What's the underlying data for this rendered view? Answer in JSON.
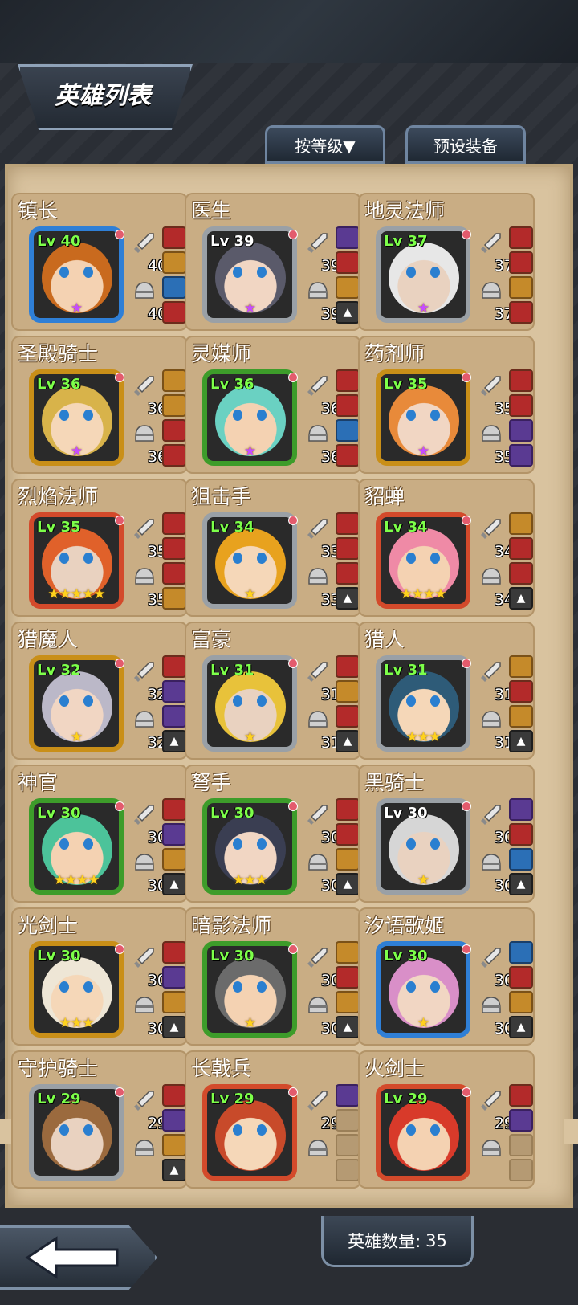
{
  "header": {
    "title": "英雄列表",
    "sort_label": "按等级▼",
    "preset_label": "预设装备"
  },
  "footer": {
    "count_label": "英雄数量:",
    "count_value": "35"
  },
  "heroes": [
    {
      "name": "镇长",
      "level": "Lv 40",
      "attack": "40",
      "defense": "40",
      "stars": "★",
      "star_color": "purple",
      "frame": "blue",
      "lv_color": "green"
    },
    {
      "name": "医生",
      "level": "Lv 39",
      "attack": "39",
      "defense": "39",
      "stars": "★",
      "star_color": "purple",
      "frame": "gray",
      "lv_color": "white"
    },
    {
      "name": "地灵法师",
      "level": "Lv 37",
      "attack": "37",
      "defense": "37",
      "stars": "★",
      "star_color": "purple",
      "frame": "gray",
      "lv_color": "green"
    },
    {
      "name": "圣殿骑士",
      "level": "Lv 36",
      "attack": "36",
      "defense": "36",
      "stars": "★",
      "star_color": "purple",
      "frame": "gold",
      "lv_color": "green"
    },
    {
      "name": "灵媒师",
      "level": "Lv 36",
      "attack": "36",
      "defense": "36",
      "stars": "★",
      "star_color": "purple",
      "frame": "green",
      "lv_color": "green"
    },
    {
      "name": "药剂师",
      "level": "Lv 35",
      "attack": "35",
      "defense": "35",
      "stars": "★",
      "star_color": "purple",
      "frame": "gold",
      "lv_color": "green"
    },
    {
      "name": "烈焰法师",
      "level": "Lv 35",
      "attack": "35",
      "defense": "35",
      "stars": "★★★★★",
      "star_color": "gold",
      "frame": "red",
      "lv_color": "green"
    },
    {
      "name": "狙击手",
      "level": "Lv 34",
      "attack": "33",
      "defense": "33",
      "stars": "★",
      "star_color": "gold",
      "frame": "gray",
      "lv_color": "green"
    },
    {
      "name": "貂蝉",
      "level": "Lv 34",
      "attack": "34",
      "defense": "34",
      "stars": "★★★★",
      "star_color": "gold",
      "frame": "red",
      "lv_color": "green"
    },
    {
      "name": "猎魔人",
      "level": "Lv 32",
      "attack": "32",
      "defense": "32",
      "stars": "★",
      "star_color": "gold",
      "frame": "gold",
      "lv_color": "green"
    },
    {
      "name": "富豪",
      "level": "Lv 31",
      "attack": "31",
      "defense": "31",
      "stars": "★",
      "star_color": "gold",
      "frame": "gray",
      "lv_color": "green"
    },
    {
      "name": "猎人",
      "level": "Lv 31",
      "attack": "31",
      "defense": "31",
      "stars": "★★★",
      "star_color": "gold",
      "frame": "gray",
      "lv_color": "green"
    },
    {
      "name": "神官",
      "level": "Lv 30",
      "attack": "30",
      "defense": "30",
      "stars": "★★★★",
      "star_color": "gold",
      "frame": "green",
      "lv_color": "green"
    },
    {
      "name": "弩手",
      "level": "Lv 30",
      "attack": "30",
      "defense": "30",
      "stars": "★★★",
      "star_color": "gold",
      "frame": "green",
      "lv_color": "green"
    },
    {
      "name": "黑骑士",
      "level": "Lv 30",
      "attack": "30",
      "defense": "30",
      "stars": "★",
      "star_color": "gold",
      "frame": "gray",
      "lv_color": "white"
    },
    {
      "name": "光剑士",
      "level": "Lv 30",
      "attack": "30",
      "defense": "30",
      "stars": "★★★",
      "star_color": "gold",
      "frame": "gold",
      "lv_color": "green"
    },
    {
      "name": "暗影法师",
      "level": "Lv 30",
      "attack": "30",
      "defense": "30",
      "stars": "★",
      "star_color": "gold",
      "frame": "green",
      "lv_color": "green"
    },
    {
      "name": "汐语歌姬",
      "level": "Lv 30",
      "attack": "30",
      "defense": "30",
      "stars": "★",
      "star_color": "gold",
      "frame": "blue",
      "lv_color": "green"
    },
    {
      "name": "守护骑士",
      "level": "Lv 29",
      "attack": "29",
      "defense": "",
      "stars": "",
      "star_color": "gold",
      "frame": "gray",
      "lv_color": "green"
    },
    {
      "name": "长戟兵",
      "level": "Lv 29",
      "attack": "29",
      "defense": "",
      "stars": "",
      "star_color": "gold",
      "frame": "red",
      "lv_color": "green"
    },
    {
      "name": "火剑士",
      "level": "Lv 29",
      "attack": "29",
      "defense": "",
      "stars": "",
      "star_color": "gold",
      "frame": "red",
      "lv_color": "green"
    }
  ],
  "colors": {
    "panel": "#d9c39f",
    "card": "#c9ad84",
    "level_green": "#7dff4a",
    "star_gold": "#ffd21d",
    "star_purple": "#c64cff"
  },
  "icons": {
    "back": "back-arrow-icon",
    "attack": "sword-icon",
    "defense": "helmet-icon",
    "lock": "lock-icon"
  }
}
